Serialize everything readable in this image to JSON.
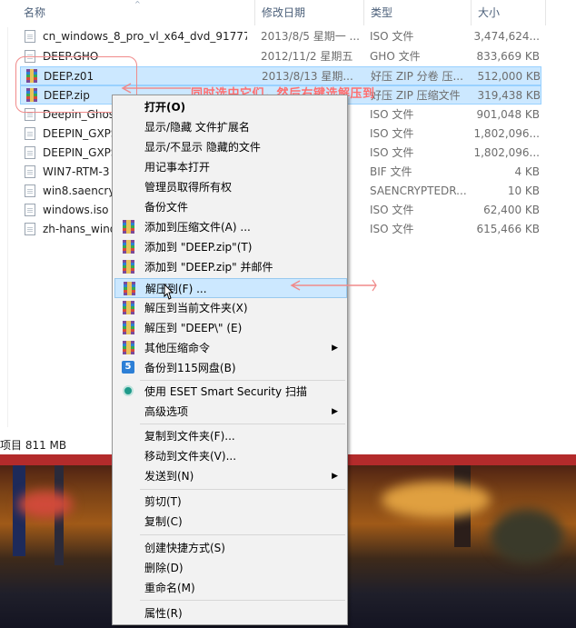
{
  "columns": {
    "name": "名称",
    "date": "修改日期",
    "type": "类型",
    "size": "大小"
  },
  "files": [
    {
      "name": "cn_windows_8_pro_vl_x64_dvd_91777...",
      "date": "2013/8/5 星期一 ...",
      "type": "ISO 文件",
      "size": "3,474,624...",
      "icon": "file-icon",
      "selected": false
    },
    {
      "name": "DEEP.GHO",
      "date": "2012/11/2 星期五",
      "type": "GHO 文件",
      "size": "833,669 KB",
      "icon": "file-icon",
      "selected": false
    },
    {
      "name": "DEEP.z01",
      "date": "2013/8/13 星期...",
      "type": "好压 ZIP 分卷 压...",
      "size": "512,000 KB",
      "icon": "winrar-icon",
      "selected": true
    },
    {
      "name": "DEEP.zip",
      "date": "",
      "type": "好压 ZIP 压缩文件",
      "size": "319,438 KB",
      "icon": "winrar-icon",
      "selected": true
    },
    {
      "name": "Deepin_Ghos",
      "date": "",
      "type": "ISO 文件",
      "size": "901,048 KB",
      "icon": "file-icon",
      "selected": false
    },
    {
      "name": "DEEPIN_GXPS",
      "date": "",
      "type": "ISO 文件",
      "size": "1,802,096...",
      "icon": "file-icon",
      "selected": false
    },
    {
      "name": "DEEPIN_GXPS",
      "date": "",
      "type": "ISO 文件",
      "size": "1,802,096...",
      "icon": "file-icon",
      "selected": false
    },
    {
      "name": "WIN7-RTM-3",
      "date": "",
      "type": "BIF 文件",
      "size": "4 KB",
      "icon": "file-icon",
      "selected": false
    },
    {
      "name": "win8.saencryp",
      "date": "",
      "type": "SAENCRYPTEDR...",
      "size": "10 KB",
      "icon": "file-icon",
      "selected": false
    },
    {
      "name": "windows.iso",
      "date": "",
      "type": "ISO 文件",
      "size": "62,400 KB",
      "icon": "file-icon",
      "selected": false
    },
    {
      "name": "zh-hans_wind",
      "date": "",
      "type": "ISO 文件",
      "size": "615,466 KB",
      "icon": "file-icon",
      "selected": false
    }
  ],
  "status": "项目 811 MB",
  "annotation": "同时选中它们，然后右键选解压到",
  "menu": {
    "open": "打开(O)",
    "toggle_ext": "显示/隐藏 文件扩展名",
    "toggle_hidden": "显示/不显示 隐藏的文件",
    "open_notepad": "用记事本打开",
    "take_ownership": "管理员取得所有权",
    "backup_file": "备份文件",
    "add_archive": "添加到压缩文件(A) ...",
    "add_deep_zip": "添加到 \"DEEP.zip\"(T)",
    "add_deep_zip_mail": "添加到 \"DEEP.zip\" 并邮件",
    "extract_to": "解压到(F) ...",
    "extract_here": "解压到当前文件夹(X)",
    "extract_deep": "解压到 \"DEEP\\\" (E)",
    "other_cmds": "其他压缩命令",
    "backup_115": "备份到115网盘(B)",
    "eset_scan": "使用 ESET Smart Security 扫描",
    "advanced": "高级选项",
    "copy_to": "复制到文件夹(F)...",
    "move_to": "移动到文件夹(V)...",
    "send_to": "发送到(N)",
    "cut": "剪切(T)",
    "copy": "复制(C)",
    "create_shortcut": "创建快捷方式(S)",
    "delete": "删除(D)",
    "rename": "重命名(M)",
    "properties": "属性(R)"
  },
  "colors": {
    "selection": "#cce8ff",
    "annotation": "#ff6e6e",
    "menu_bg": "#f2f2f2"
  }
}
